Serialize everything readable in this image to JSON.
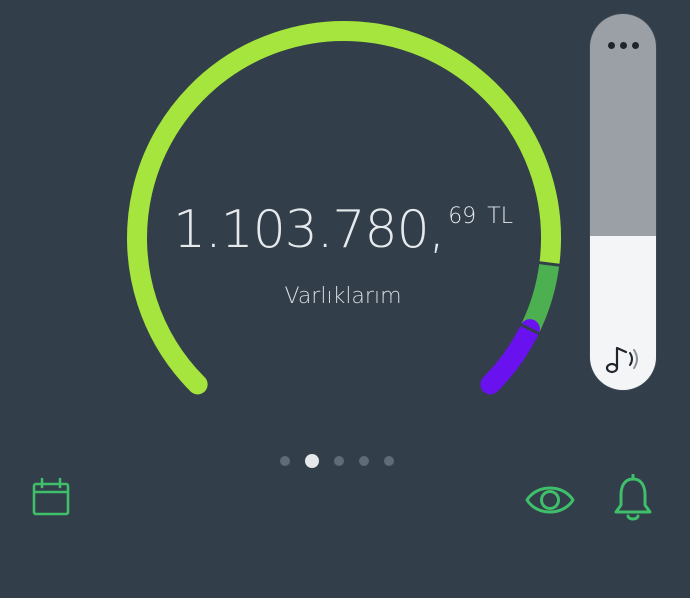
{
  "balance": {
    "integer_part": "1.103.780,",
    "decimal_part": "69",
    "currency": "TL",
    "label": "Varlıklarım"
  },
  "gauge": {
    "segments": [
      {
        "name": "lime",
        "color": "#a5e53d",
        "fraction": 0.86
      },
      {
        "name": "green",
        "color": "#4caf50",
        "fraction": 0.07
      },
      {
        "name": "purple",
        "color": "#6a11f0",
        "fraction": 0.07
      }
    ]
  },
  "pagination": {
    "count": 5,
    "active_index": 1
  },
  "volume": {
    "level": 0.41
  },
  "colors": {
    "background": "#323e4a",
    "icon_accent": "#3fbf6a",
    "text": "#e6e9ec"
  },
  "icons": {
    "calendar": "calendar-icon",
    "eye": "eye-icon",
    "bell": "bell-icon",
    "more": "more-dots-icon",
    "sound": "music-note-icon"
  }
}
